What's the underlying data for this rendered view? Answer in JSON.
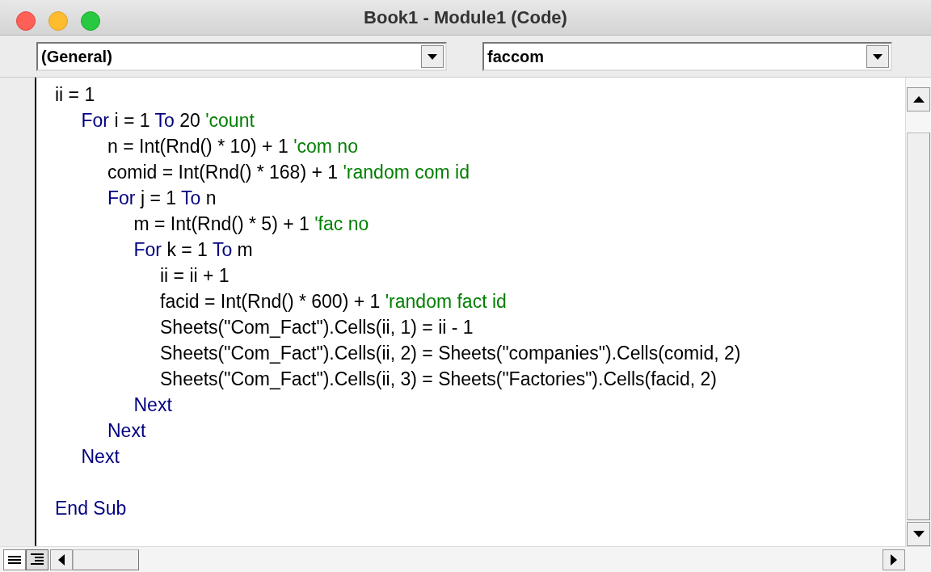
{
  "window": {
    "title": "Book1 - Module1 (Code)"
  },
  "object_dropdown": {
    "value": "(General)"
  },
  "procedure_dropdown": {
    "value": "faccom"
  },
  "code": [
    {
      "kind": "code",
      "tokens": [
        {
          "kind": "plain",
          "text": "ii = 1"
        }
      ]
    },
    {
      "kind": "group",
      "children": [
        {
          "kind": "code",
          "tokens": [
            {
              "kind": "keyword",
              "text": "For"
            },
            {
              "kind": "plain",
              "text": " i = 1 "
            },
            {
              "kind": "keyword",
              "text": "To"
            },
            {
              "kind": "plain",
              "text": " 20 "
            },
            {
              "kind": "comment",
              "text": "'count"
            }
          ],
          "children": [
            {
              "kind": "code",
              "tokens": [
                {
                  "kind": "plain",
                  "text": "n = Int(Rnd() * 10) + 1 "
                },
                {
                  "kind": "comment",
                  "text": "'com no"
                }
              ]
            },
            {
              "kind": "code",
              "tokens": [
                {
                  "kind": "plain",
                  "text": "comid = Int(Rnd() * 168) + 1 "
                },
                {
                  "kind": "comment",
                  "text": "'random com id"
                }
              ]
            },
            {
              "kind": "code",
              "tokens": [
                {
                  "kind": "keyword",
                  "text": "For"
                },
                {
                  "kind": "plain",
                  "text": " j = 1 "
                },
                {
                  "kind": "keyword",
                  "text": "To"
                },
                {
                  "kind": "plain",
                  "text": " n"
                }
              ],
              "children": [
                {
                  "kind": "code",
                  "tokens": [
                    {
                      "kind": "plain",
                      "text": "m = Int(Rnd() * 5) + 1 "
                    },
                    {
                      "kind": "comment",
                      "text": "'fac no"
                    }
                  ]
                },
                {
                  "kind": "code",
                  "tokens": [
                    {
                      "kind": "keyword",
                      "text": "For"
                    },
                    {
                      "kind": "plain",
                      "text": " k = 1 "
                    },
                    {
                      "kind": "keyword",
                      "text": "To"
                    },
                    {
                      "kind": "plain",
                      "text": " m"
                    }
                  ],
                  "children": [
                    {
                      "kind": "code",
                      "tokens": [
                        {
                          "kind": "plain",
                          "text": "ii = ii + 1"
                        }
                      ]
                    },
                    {
                      "kind": "code",
                      "tokens": [
                        {
                          "kind": "plain",
                          "text": "facid = Int(Rnd() * 600) + 1 "
                        },
                        {
                          "kind": "comment",
                          "text": "'random fact id"
                        }
                      ]
                    },
                    {
                      "kind": "code",
                      "tokens": [
                        {
                          "kind": "plain",
                          "text": "Sheets(\"Com_Fact\").Cells(ii, 1) = ii - 1"
                        }
                      ]
                    },
                    {
                      "kind": "code",
                      "tokens": [
                        {
                          "kind": "plain",
                          "text": "Sheets(\"Com_Fact\").Cells(ii, 2) = Sheets(\"companies\").Cells(comid, 2)"
                        }
                      ]
                    },
                    {
                      "kind": "code",
                      "tokens": [
                        {
                          "kind": "plain",
                          "text": "Sheets(\"Com_Fact\").Cells(ii, 3) = Sheets(\"Factories\").Cells(facid, 2)"
                        }
                      ]
                    }
                  ]
                },
                {
                  "kind": "code",
                  "tokens": [
                    {
                      "kind": "keyword",
                      "text": "Next"
                    }
                  ]
                }
              ]
            },
            {
              "kind": "code",
              "tokens": [
                {
                  "kind": "keyword",
                  "text": "Next"
                }
              ]
            }
          ]
        },
        {
          "kind": "code",
          "tokens": [
            {
              "kind": "keyword",
              "text": "Next"
            }
          ]
        }
      ]
    },
    {
      "kind": "blank"
    },
    {
      "kind": "code",
      "tokens": [
        {
          "kind": "keyword",
          "text": "End Sub"
        }
      ]
    }
  ]
}
